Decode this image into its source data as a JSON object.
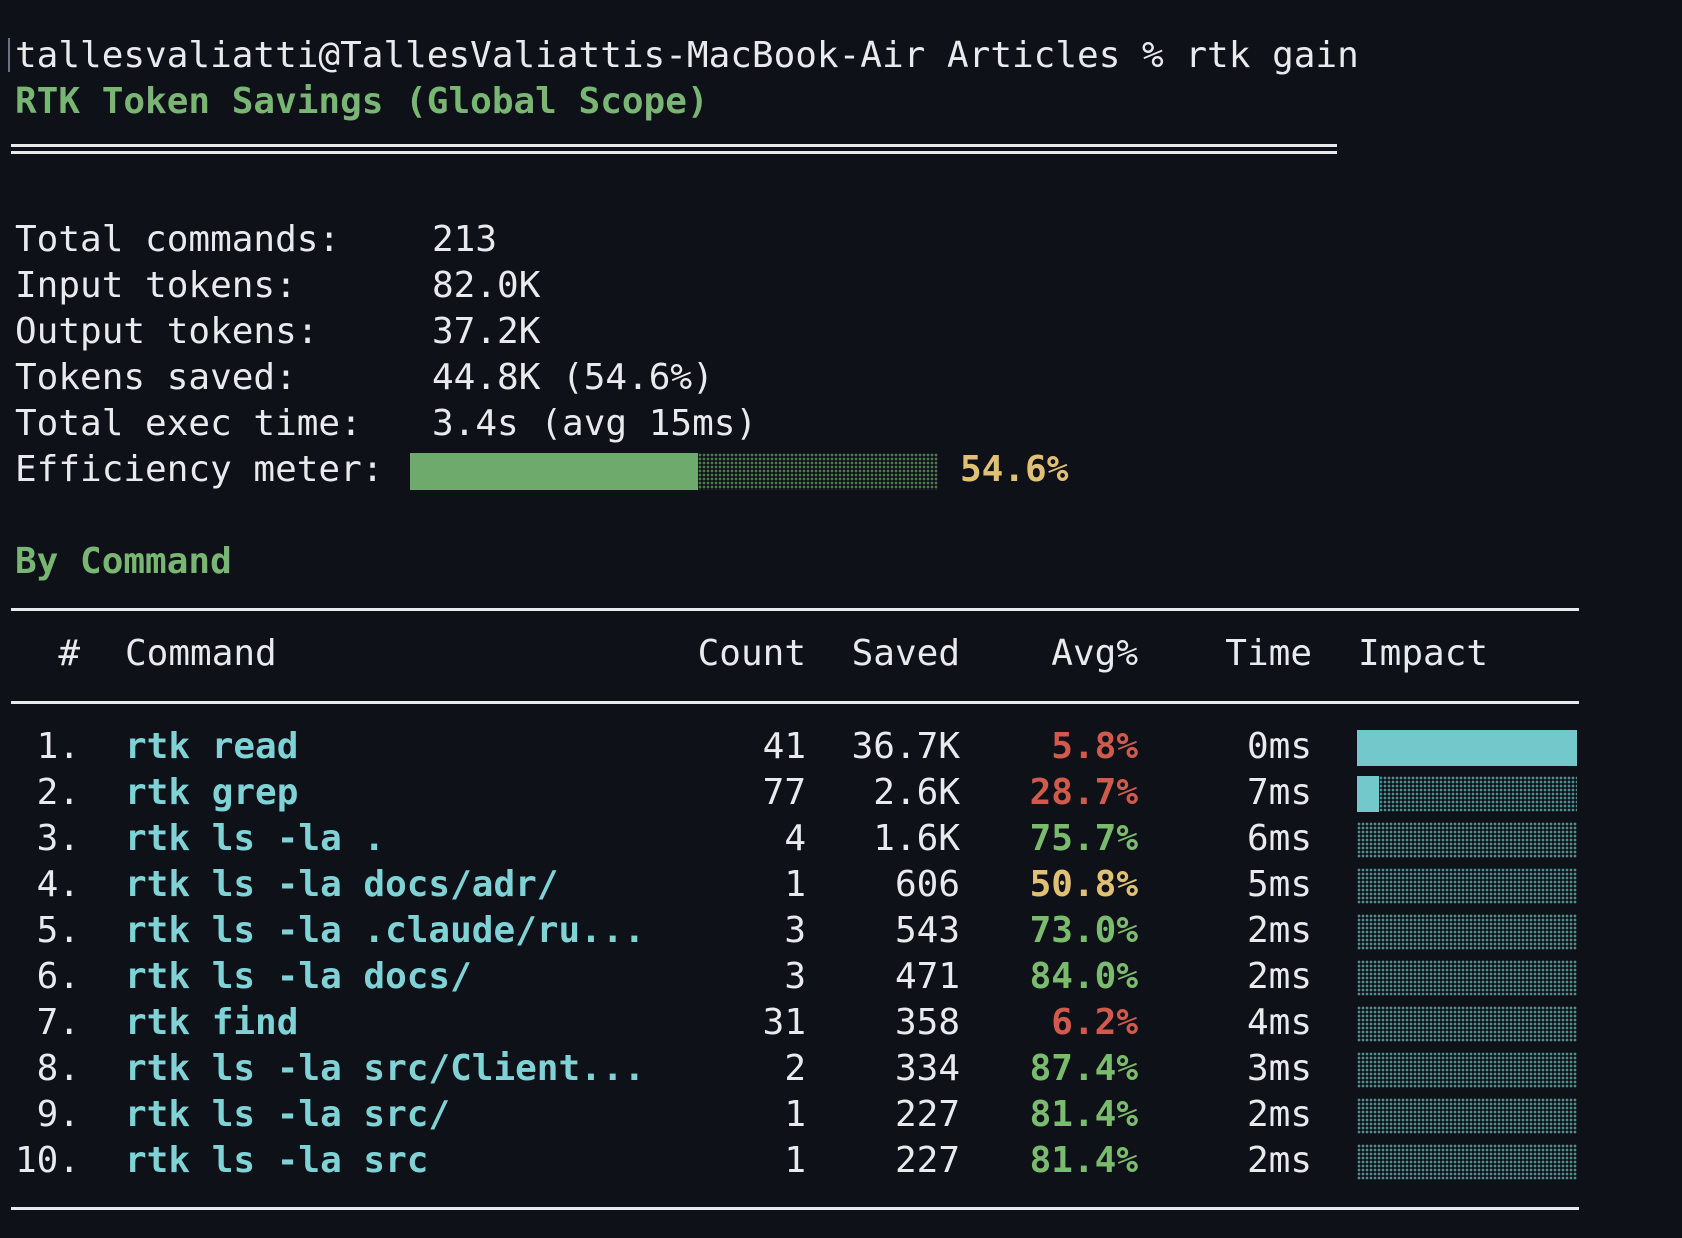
{
  "terminal": {
    "prompt": "tallesvaliatti@TallesValiattis-MacBook-Air Articles % rtk gain",
    "title": "RTK Token Savings (Global Scope)"
  },
  "summary": {
    "total_commands_label": "Total commands:",
    "total_commands": "213",
    "input_tokens_label": "Input tokens:",
    "input_tokens": "82.0K",
    "output_tokens_label": "Output tokens:",
    "output_tokens": "37.2K",
    "tokens_saved_label": "Tokens saved:",
    "tokens_saved": "44.8K (54.6%)",
    "exec_time_label": "Total exec time:",
    "exec_time": "3.4s (avg 15ms)",
    "efficiency_label": "Efficiency meter:",
    "efficiency_value": "54.6%",
    "efficiency_fraction": 0.546
  },
  "by_command": {
    "heading": "By Command",
    "headers": {
      "num": "#",
      "command": "Command",
      "count": "Count",
      "saved": "Saved",
      "avg": "Avg%",
      "time": "Time",
      "impact": "Impact"
    },
    "rows": [
      {
        "num": "1.",
        "command": "rtk read",
        "count": "41",
        "saved": "36.7K",
        "avg": "5.8%",
        "avg_color": "red",
        "time": "0ms",
        "impact": 1.0
      },
      {
        "num": "2.",
        "command": "rtk grep",
        "count": "77",
        "saved": "2.6K",
        "avg": "28.7%",
        "avg_color": "red",
        "time": "7ms",
        "impact": 0.1
      },
      {
        "num": "3.",
        "command": "rtk ls -la .",
        "count": "4",
        "saved": "1.6K",
        "avg": "75.7%",
        "avg_color": "green",
        "time": "6ms",
        "impact": 0.0
      },
      {
        "num": "4.",
        "command": "rtk ls -la docs/adr/",
        "count": "1",
        "saved": "606",
        "avg": "50.8%",
        "avg_color": "yellow",
        "time": "5ms",
        "impact": 0.0
      },
      {
        "num": "5.",
        "command": "rtk ls -la .claude/ru...",
        "count": "3",
        "saved": "543",
        "avg": "73.0%",
        "avg_color": "green",
        "time": "2ms",
        "impact": 0.0
      },
      {
        "num": "6.",
        "command": "rtk ls -la docs/",
        "count": "3",
        "saved": "471",
        "avg": "84.0%",
        "avg_color": "green",
        "time": "2ms",
        "impact": 0.0
      },
      {
        "num": "7.",
        "command": "rtk find",
        "count": "31",
        "saved": "358",
        "avg": "6.2%",
        "avg_color": "red",
        "time": "4ms",
        "impact": 0.0
      },
      {
        "num": "8.",
        "command": "rtk ls -la src/Client...",
        "count": "2",
        "saved": "334",
        "avg": "87.4%",
        "avg_color": "green",
        "time": "3ms",
        "impact": 0.0
      },
      {
        "num": "9.",
        "command": "rtk ls -la src/",
        "count": "1",
        "saved": "227",
        "avg": "81.4%",
        "avg_color": "green",
        "time": "2ms",
        "impact": 0.0
      },
      {
        "num": "10.",
        "command": "rtk ls -la src",
        "count": "1",
        "saved": "227",
        "avg": "81.4%",
        "avg_color": "green",
        "time": "2ms",
        "impact": 0.0
      }
    ]
  },
  "colors": {
    "background": "#0e1218",
    "text": "#e8eaed",
    "heading_green": "#79b573",
    "command_cyan": "#7fd3d6",
    "red": "#d05a4c",
    "yellow": "#e0c074",
    "green": "#7bbb6e"
  }
}
